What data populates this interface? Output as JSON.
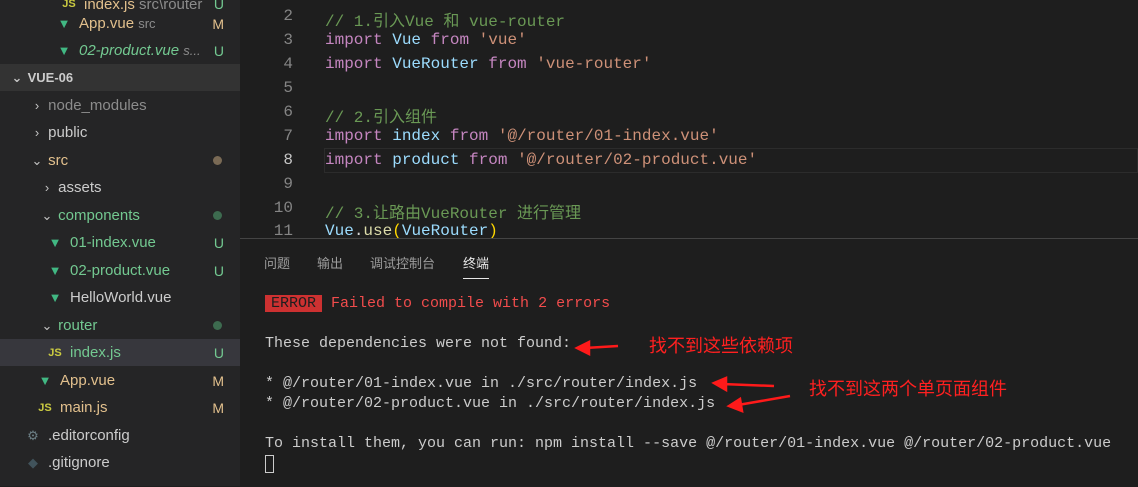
{
  "sidebar": {
    "open_editors": [
      {
        "name": "index.js",
        "path": "src\\router",
        "badge": "U"
      },
      {
        "name": "App.vue",
        "path": "src",
        "badge": "M"
      },
      {
        "name": "02-product.vue",
        "path": "s...",
        "badge": "U"
      }
    ],
    "project": "VUE-06",
    "tree": {
      "node_modules": "node_modules",
      "public": "public",
      "src": "src",
      "assets": "assets",
      "components": "components",
      "f1": "01-index.vue",
      "f1b": "U",
      "f2": "02-product.vue",
      "f2b": "U",
      "f3": "HelloWorld.vue",
      "router": "router",
      "f4": "index.js",
      "f4b": "U",
      "app": "App.vue",
      "appb": "M",
      "main": "main.js",
      "mainb": "M",
      "editorconfig": ".editorconfig",
      "gitignore": ".gitignore"
    }
  },
  "editor": {
    "lines": {
      "n2": "2",
      "n3": "3",
      "n4": "4",
      "n5": "5",
      "n6": "6",
      "n7": "7",
      "n8": "8",
      "n9": "9",
      "n10": "10",
      "n11": "11"
    },
    "c2": "// 1.引入Vue 和 vue-router",
    "import": "import",
    "from": "from",
    "vue": "Vue",
    "s3": "'vue'",
    "vr": "VueRouter",
    "s4": "'vue-router'",
    "c6": "// 2.引入组件",
    "index": "index",
    "s7": "'@/router/01-index.vue'",
    "product": "product",
    "s8": "'@/router/02-product.vue'",
    "c10": "// 3.让路由VueRouter 进行管理",
    "use": "use",
    "vr2": "VueRouter"
  },
  "panel": {
    "tabs": [
      "问题",
      "输出",
      "调试控制台",
      "终端"
    ],
    "error_badge": "ERROR",
    "error_msg": "Failed to compile with 2 errors",
    "l1": "These dependencies were not found:",
    "l2": "* @/router/01-index.vue in ./src/router/index.js",
    "l3": "* @/router/02-product.vue in ./src/router/index.js",
    "l4": "To install them, you can run: npm install --save @/router/01-index.vue @/router/02-product.vue"
  },
  "annotations": {
    "a1": "找不到这些依赖项",
    "a2": "找不到这两个单页面组件"
  }
}
